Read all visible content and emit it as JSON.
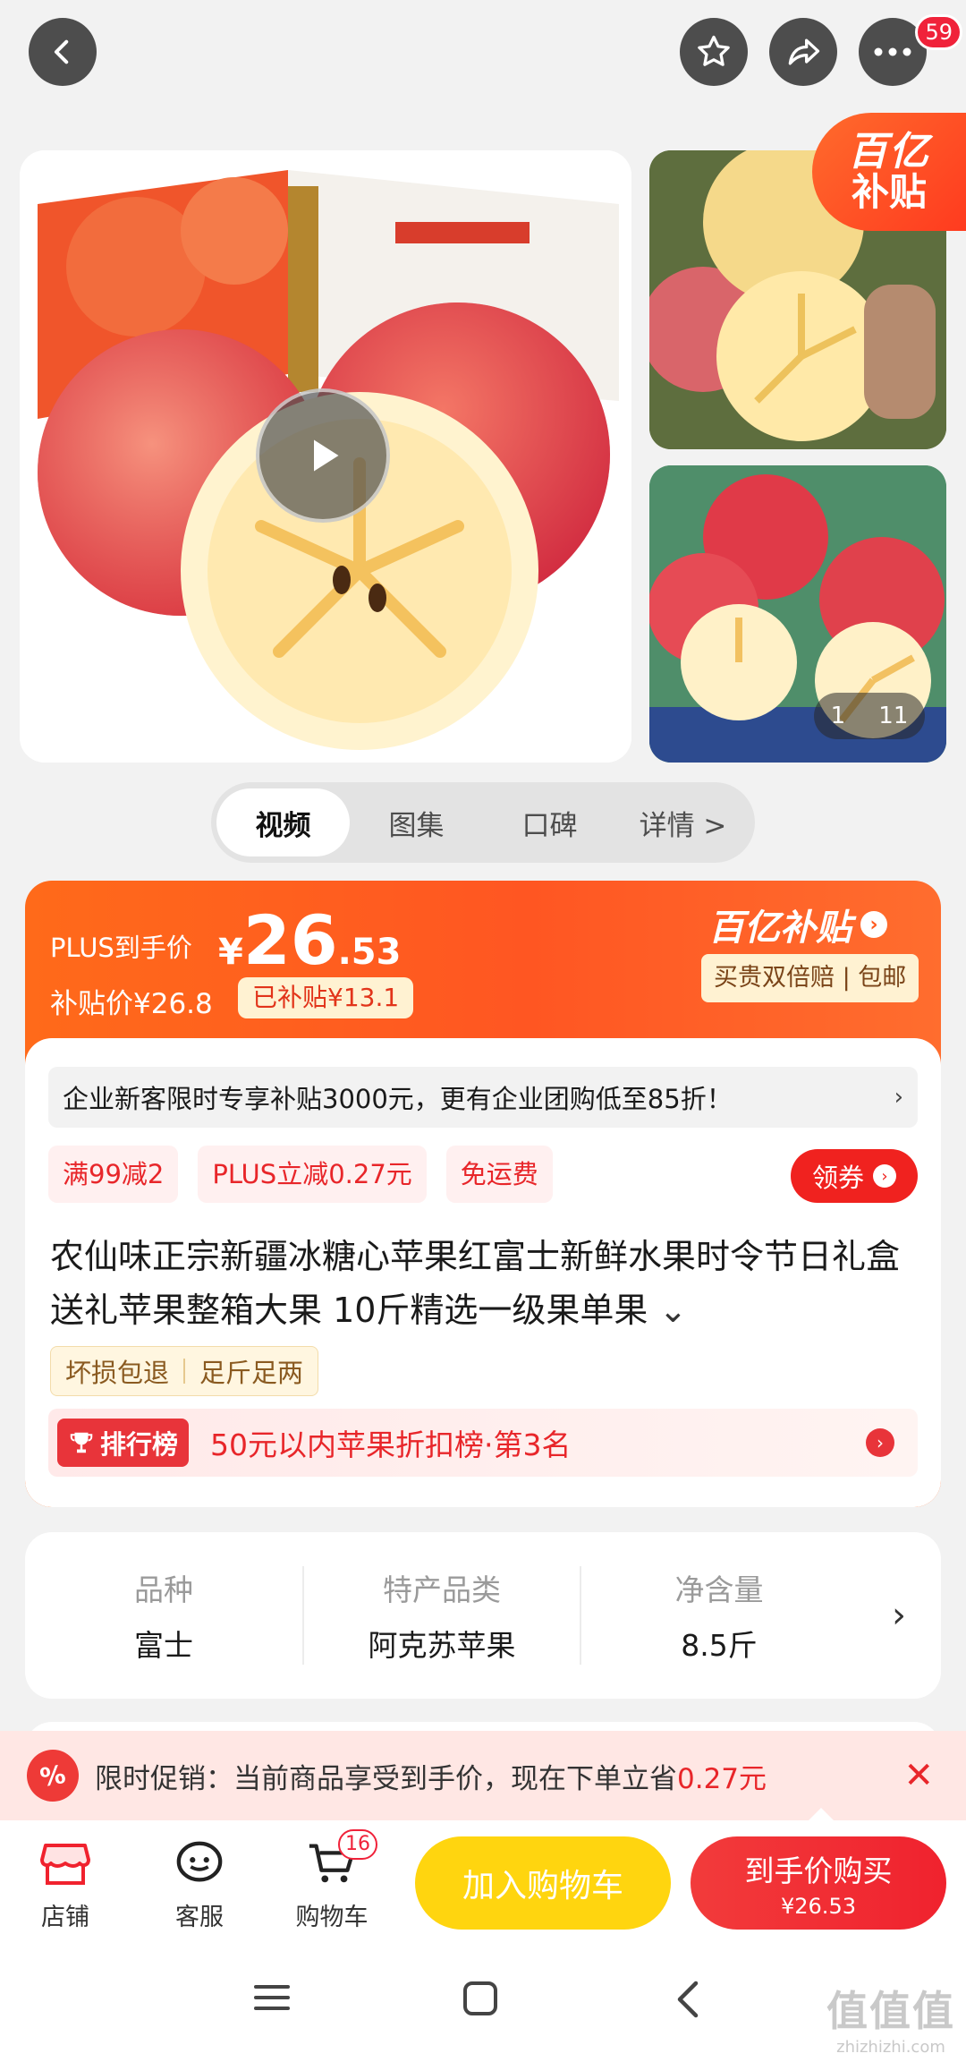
{
  "top_nav": {
    "notification_count": "59"
  },
  "gallery": {
    "subsidy_corner": {
      "line1": "百亿",
      "line2": "补贴"
    },
    "counter": {
      "current": "1",
      "total": "11"
    }
  },
  "tabs": [
    {
      "label": "视频"
    },
    {
      "label": "图集"
    },
    {
      "label": "口碑"
    },
    {
      "label": "详情 >"
    }
  ],
  "price": {
    "plus_label": "PLUS到手价",
    "currency": "¥",
    "integer": "26",
    "decimal": ".53",
    "subsidy_price": "补贴价¥26.8",
    "subsidized_tag": "已补贴¥13.1",
    "brand": "百亿补贴",
    "guarantee": "买贵双倍赔 | 包邮"
  },
  "biz_notice": "企业新客限时专享补贴3000元，更有企业团购低至85折！",
  "chips": [
    "满99减2",
    "PLUS立减0.27元",
    "免运费"
  ],
  "coupon_button": "领券",
  "product_title": "农仙味正宗新疆冰糖心苹果红富士新鲜水果时令节日礼盒送礼苹果整箱大果 10斤精选一级果单果",
  "services": [
    "坏损包退",
    "足斤足两"
  ],
  "rank": {
    "tag": "排行榜",
    "text": "50元以内苹果折扣榜·第3名"
  },
  "specs": [
    {
      "label": "品种",
      "value": "富士"
    },
    {
      "label": "特产品类",
      "value": "阿克苏苹果"
    },
    {
      "label": "净含量",
      "value": "8.5斤"
    }
  ],
  "promo": {
    "text": "限时促销：当前商品享受到手价，现在下单立省",
    "amount": "0.27元"
  },
  "actions": {
    "store": "店铺",
    "service": "客服",
    "cart": "购物车",
    "cart_count": "16",
    "add_to_cart": "加入购物车",
    "buy_line1": "到手价购买",
    "buy_line2": "¥26.53"
  },
  "watermark": {
    "line1": "值值值",
    "line2": "zhizhizhi.com"
  },
  "colors": {
    "accent": "#ff5a1f",
    "red": "#f0221f",
    "yellow": "#ffd50f"
  }
}
